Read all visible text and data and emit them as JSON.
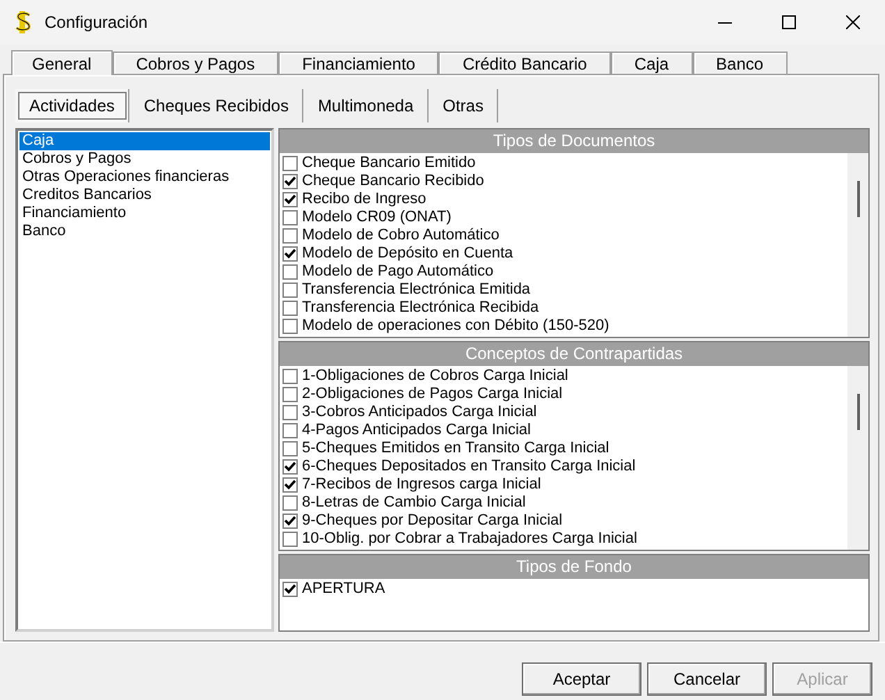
{
  "window": {
    "title": "Configuración"
  },
  "tabs": [
    {
      "label": "General",
      "selected": true
    },
    {
      "label": "Cobros y Pagos",
      "selected": false
    },
    {
      "label": "Financiamiento",
      "selected": false
    },
    {
      "label": "Crédito Bancario",
      "selected": false
    },
    {
      "label": "Caja",
      "selected": false
    },
    {
      "label": "Banco",
      "selected": false
    }
  ],
  "subtabs": [
    {
      "label": "Actividades",
      "selected": true
    },
    {
      "label": "Cheques Recibidos",
      "selected": false
    },
    {
      "label": "Multimoneda",
      "selected": false
    },
    {
      "label": "Otras",
      "selected": false
    }
  ],
  "activities": [
    {
      "label": "Caja",
      "selected": true
    },
    {
      "label": "Cobros y Pagos",
      "selected": false
    },
    {
      "label": "Otras Operaciones financieras",
      "selected": false
    },
    {
      "label": "Creditos Bancarios",
      "selected": false
    },
    {
      "label": "Financiamiento",
      "selected": false
    },
    {
      "label": "Banco",
      "selected": false
    }
  ],
  "sections": [
    {
      "title": "Tipos de Documentos",
      "scrollbar": true,
      "items": [
        {
          "label": "Cheque Bancario Emitido",
          "checked": false
        },
        {
          "label": "Cheque Bancario Recibido",
          "checked": true
        },
        {
          "label": "Recibo de Ingreso",
          "checked": true
        },
        {
          "label": "Modelo CR09 (ONAT)",
          "checked": false
        },
        {
          "label": "Modelo de Cobro Automático",
          "checked": false
        },
        {
          "label": "Modelo de Depósito en Cuenta",
          "checked": true
        },
        {
          "label": "Modelo de Pago Automático",
          "checked": false
        },
        {
          "label": "Transferencia Electrónica Emitida",
          "checked": false
        },
        {
          "label": "Transferencia Electrónica Recibida",
          "checked": false
        },
        {
          "label": "Modelo de operaciones con Débito (150-520)",
          "checked": false
        }
      ]
    },
    {
      "title": "Conceptos de Contrapartidas",
      "scrollbar": true,
      "items": [
        {
          "label": "1-Obligaciones de Cobros Carga Inicial",
          "checked": false
        },
        {
          "label": "2-Obligaciones de Pagos Carga Inicial",
          "checked": false
        },
        {
          "label": "3-Cobros Anticipados Carga Inicial",
          "checked": false
        },
        {
          "label": "4-Pagos Anticipados Carga Inicial",
          "checked": false
        },
        {
          "label": "5-Cheques Emitidos en Transito Carga Inicial",
          "checked": false
        },
        {
          "label": "6-Cheques Depositados en Transito Carga Inicial",
          "checked": true
        },
        {
          "label": "7-Recibos de Ingresos carga Inicial",
          "checked": true
        },
        {
          "label": "8-Letras de Cambio Carga Inicial",
          "checked": false
        },
        {
          "label": "9-Cheques por Depositar Carga Inicial",
          "checked": true
        },
        {
          "label": "10-Oblig. por Cobrar a Trabajadores Carga Inicial",
          "checked": false
        }
      ]
    },
    {
      "title": "Tipos de Fondo",
      "scrollbar": false,
      "items": [
        {
          "label": "APERTURA",
          "checked": true
        }
      ]
    }
  ],
  "buttons": [
    {
      "label": "Aceptar",
      "disabled": false
    },
    {
      "label": "Cancelar",
      "disabled": false
    },
    {
      "label": "Aplicar",
      "disabled": true
    }
  ]
}
